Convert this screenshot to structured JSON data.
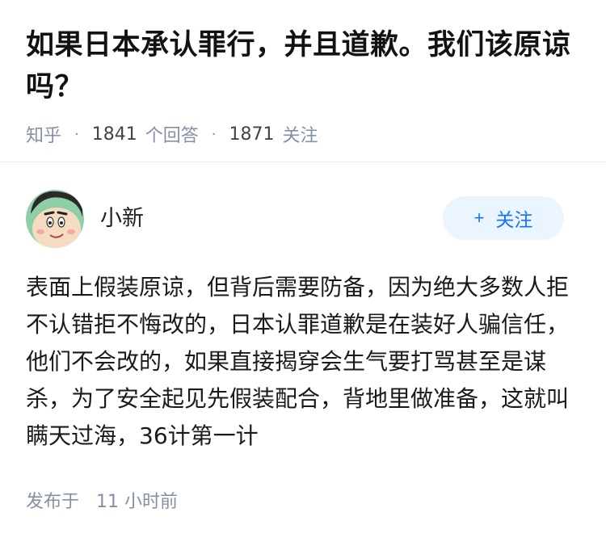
{
  "question": {
    "title": "如果日本承认罪行，并且道歉。我们该原谅吗？",
    "source": "知乎",
    "answer_count": "1841",
    "answer_count_label": "个回答",
    "follow_count": "1871",
    "follow_count_label": "关注",
    "separator": "·"
  },
  "answer": {
    "author": {
      "name": "小新",
      "avatar_icon": "avatar-cartoon-icon"
    },
    "follow_button": {
      "plus": "+",
      "label": "关注"
    },
    "content": "表面上假装原谅，但背后需要防备，因为绝大多数人拒不认错拒不悔改的，日本认罪道歉是在装好人骗信任，他们不会改的，如果直接揭穿会生气要打骂甚至是谋杀，为了安全起见先假装配合，背地里做准备，这就叫瞒天过海，36计第一计",
    "time_label": "发布于",
    "time_value": "11 小时前"
  },
  "colors": {
    "accent": "#1772f6",
    "accent_bg": "#ebf5ff",
    "meta": "#8590a6"
  }
}
